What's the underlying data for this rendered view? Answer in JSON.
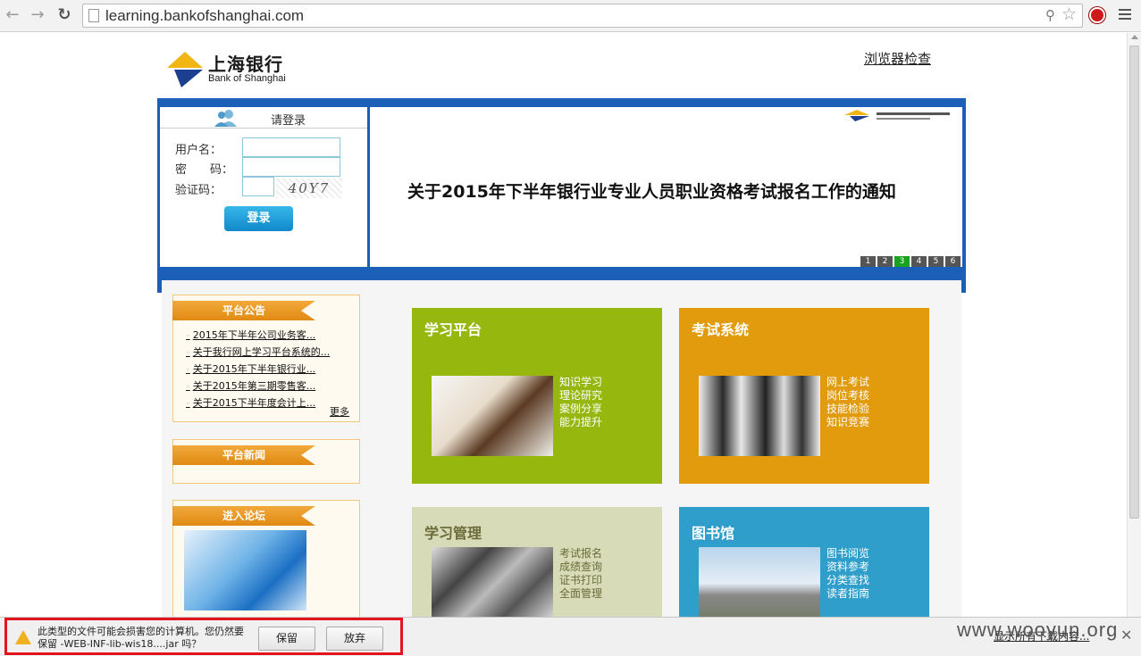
{
  "browser": {
    "url": "learning.bankofshanghai.com"
  },
  "header": {
    "logo_cn": "上海银行",
    "logo_en": "Bank of Shanghai",
    "browser_check": "浏览器检查",
    "brand_blue": "#1b5fb8",
    "brand_gold": "#f1b514"
  },
  "login": {
    "title": "请登录",
    "username_label": "用户名：",
    "password_label": "密　　码：",
    "captcha_label": "验证码：",
    "captcha_text": "40Y7",
    "submit": "登录"
  },
  "banner": {
    "logo_text": "上海银行",
    "headline": "关于2015年下半年银行业专业人员职业资格考试报名工作的通知",
    "pages": [
      "1",
      "2",
      "3",
      "4",
      "5",
      "6"
    ],
    "active_page": "3"
  },
  "sidebar": {
    "notice_title": "平台公告",
    "notices": [
      "2015年下半年公司业务客...",
      "关于我行网上学习平台系统的...",
      "关于2015年下半年银行业...",
      "关于2015年第三期零售客...",
      "关于2015下半年度会计上..."
    ],
    "more": "更多",
    "news_title": "平台新闻",
    "forum_title": "进入论坛"
  },
  "tiles": {
    "study": {
      "title": "学习平台",
      "links": [
        "知识学习",
        "理论研究",
        "案例分享",
        "能力提升"
      ]
    },
    "exam": {
      "title": "考试系统",
      "links": [
        "网上考试",
        "岗位考核",
        "技能检验",
        "知识竞赛"
      ]
    },
    "manage": {
      "title": "学习管理",
      "links": [
        "考试报名",
        "成绩查询",
        "证书打印",
        "全面管理"
      ]
    },
    "library": {
      "title": "图书馆",
      "links": [
        "图书阅览",
        "资料参考",
        "分类查找",
        "读者指南"
      ]
    }
  },
  "download_bar": {
    "warning": "此类型的文件可能会损害您的计算机。您仍然要保留 -WEB-INF-lib-wis18....jar 吗？",
    "keep": "保留",
    "discard": "放弃",
    "show_all": "显示所有下载内容...",
    "watermark": "www.wooyun.org"
  }
}
